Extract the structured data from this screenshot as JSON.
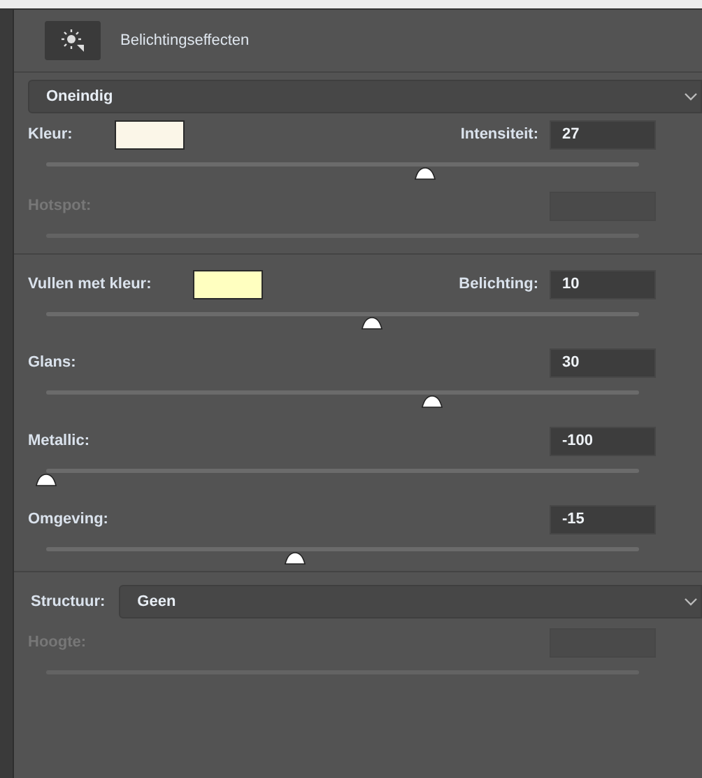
{
  "header": {
    "title": "Belichtingseffecten"
  },
  "light_type": {
    "value": "Oneindig"
  },
  "light_rows": [
    {
      "label": "Kleur:",
      "disabled": false,
      "color": "#fbf6e8",
      "value_label": "Intensiteit:",
      "value": "27",
      "level": 0.64
    },
    {
      "label": "Hotspot:",
      "disabled": true
    }
  ],
  "surface_rows": [
    {
      "label": "Vullen met kleur:",
      "disabled": false,
      "color": "#ffffc0",
      "value_label": "Belichting:",
      "value": "10",
      "level": 0.55
    },
    {
      "label": "Glans:",
      "disabled": false,
      "value": "30",
      "level": 0.65
    },
    {
      "label": "Metallic:",
      "disabled": false,
      "value": "-100",
      "level": 0
    },
    {
      "label": "Omgeving:",
      "disabled": false,
      "value": "-15",
      "level": 0.42
    }
  ],
  "texture": {
    "label": "Structuur:",
    "value": "Geen"
  },
  "texture_rows": [
    {
      "label": "Hoogte:",
      "disabled": true
    }
  ]
}
